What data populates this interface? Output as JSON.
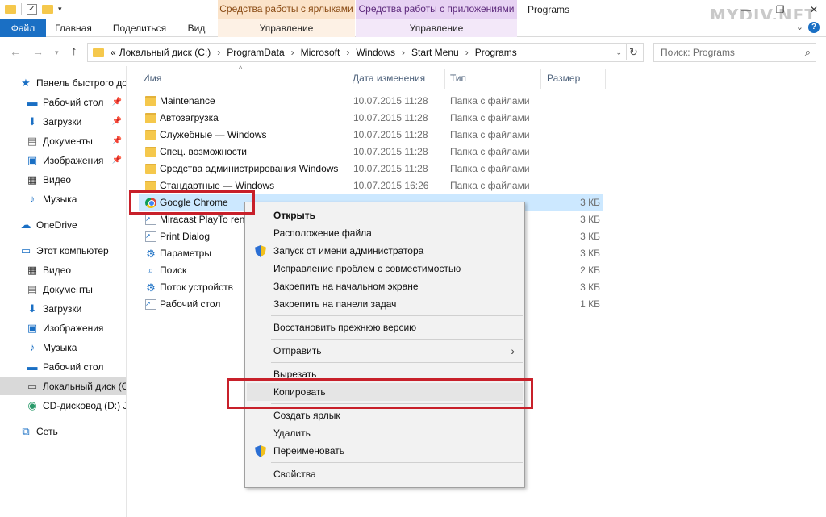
{
  "titlebar": {
    "context_tab_shortcuts": "Средства работы с ярлыками",
    "context_tab_apps": "Средства работы с приложениями",
    "window_title": "Programs",
    "watermark": "MYDIV.NET",
    "minimize": "—",
    "maximize": "❐",
    "close": "✕"
  },
  "ribbon": {
    "tabs": [
      "Файл",
      "Главная",
      "Поделиться",
      "Вид"
    ],
    "manage_shortcuts": "Управление",
    "manage_apps": "Управление"
  },
  "address": {
    "prefix": "«",
    "crumbs": [
      "Локальный диск (C:)",
      "ProgramData",
      "Microsoft",
      "Windows",
      "Start Menu",
      "Programs"
    ],
    "search_placeholder": "Поиск: Programs"
  },
  "navpane": {
    "items": [
      {
        "label": "Панель быстрого доступа",
        "icon": "star-icon"
      },
      {
        "label": "Рабочий стол",
        "icon": "desktop-icon",
        "pinned": true
      },
      {
        "label": "Загрузки",
        "icon": "download-icon",
        "pinned": true
      },
      {
        "label": "Документы",
        "icon": "documents-icon",
        "pinned": true
      },
      {
        "label": "Изображения",
        "icon": "pictures-icon",
        "pinned": true
      },
      {
        "label": "Видео",
        "icon": "video-icon"
      },
      {
        "label": "Музыка",
        "icon": "music-icon"
      },
      {
        "label": "OneDrive",
        "icon": "cloud-icon"
      },
      {
        "label": "Этот компьютер",
        "icon": "computer-icon"
      },
      {
        "label": "Видео",
        "icon": "video-icon"
      },
      {
        "label": "Документы",
        "icon": "documents-icon"
      },
      {
        "label": "Загрузки",
        "icon": "download-icon"
      },
      {
        "label": "Изображения",
        "icon": "pictures-icon"
      },
      {
        "label": "Музыка",
        "icon": "music-icon"
      },
      {
        "label": "Рабочий стол",
        "icon": "desktop-icon"
      },
      {
        "label": "Локальный диск (C:)",
        "icon": "drive-icon",
        "selected": true
      },
      {
        "label": "CD-дисковод (D:) J",
        "icon": "cd-drive-icon"
      },
      {
        "label": "Сеть",
        "icon": "network-icon"
      }
    ]
  },
  "columns": {
    "name": "Имя",
    "date": "Дата изменения",
    "type": "Тип",
    "size": "Размер"
  },
  "files": [
    {
      "name": "Maintenance",
      "date": "10.07.2015 11:28",
      "type": "Папка с файлами",
      "size": "",
      "icon": "folder"
    },
    {
      "name": "Автозагрузка",
      "date": "10.07.2015 11:28",
      "type": "Папка с файлами",
      "size": "",
      "icon": "folder"
    },
    {
      "name": "Служебные — Windows",
      "date": "10.07.2015 11:28",
      "type": "Папка с файлами",
      "size": "",
      "icon": "folder"
    },
    {
      "name": "Спец. возможности",
      "date": "10.07.2015 11:28",
      "type": "Папка с файлами",
      "size": "",
      "icon": "folder"
    },
    {
      "name": "Средства администрирования Windows",
      "date": "10.07.2015 11:28",
      "type": "Папка с файлами",
      "size": "",
      "icon": "folder"
    },
    {
      "name": "Стандартные — Windows",
      "date": "10.07.2015 16:26",
      "type": "Папка с файлами",
      "size": "",
      "icon": "folder"
    },
    {
      "name": "Google Chrome",
      "date": "",
      "type": "",
      "size": "3 КБ",
      "icon": "chrome",
      "selected": true
    },
    {
      "name": "Miracast PlayTo rend",
      "date": "",
      "type": "",
      "size": "3 КБ",
      "icon": "shortcut"
    },
    {
      "name": "Print Dialog",
      "date": "",
      "type": "",
      "size": "3 КБ",
      "icon": "shortcut"
    },
    {
      "name": "Параметры",
      "date": "",
      "type": "",
      "size": "3 КБ",
      "icon": "gear"
    },
    {
      "name": "Поиск",
      "date": "",
      "type": "",
      "size": "2 КБ",
      "icon": "search"
    },
    {
      "name": "Поток устройств",
      "date": "",
      "type": "",
      "size": "3 КБ",
      "icon": "gear"
    },
    {
      "name": "Рабочий стол",
      "date": "",
      "type": "",
      "size": "1 КБ",
      "icon": "shortcut"
    }
  ],
  "context_menu": {
    "items": [
      {
        "label": "Открыть",
        "bold": true
      },
      {
        "label": "Расположение файла"
      },
      {
        "label": "Запуск от имени администратора",
        "shield": true
      },
      {
        "label": "Исправление проблем с совместимостью"
      },
      {
        "label": "Закрепить на начальном экране"
      },
      {
        "label": "Закрепить на панели задач"
      },
      {
        "label": "Восстановить прежнюю версию"
      },
      {
        "label": "Отправить",
        "submenu": true
      },
      {
        "label": "Вырезать"
      },
      {
        "label": "Копировать",
        "hover": true
      },
      {
        "label": "Создать ярлык"
      },
      {
        "label": "Удалить"
      },
      {
        "label": "Переименовать",
        "shield": true
      },
      {
        "label": "Свойства"
      }
    ]
  },
  "colors": {
    "file_tab": "#1a6fc4",
    "selection": "#cce8ff",
    "highlight_box": "#c8202a"
  }
}
